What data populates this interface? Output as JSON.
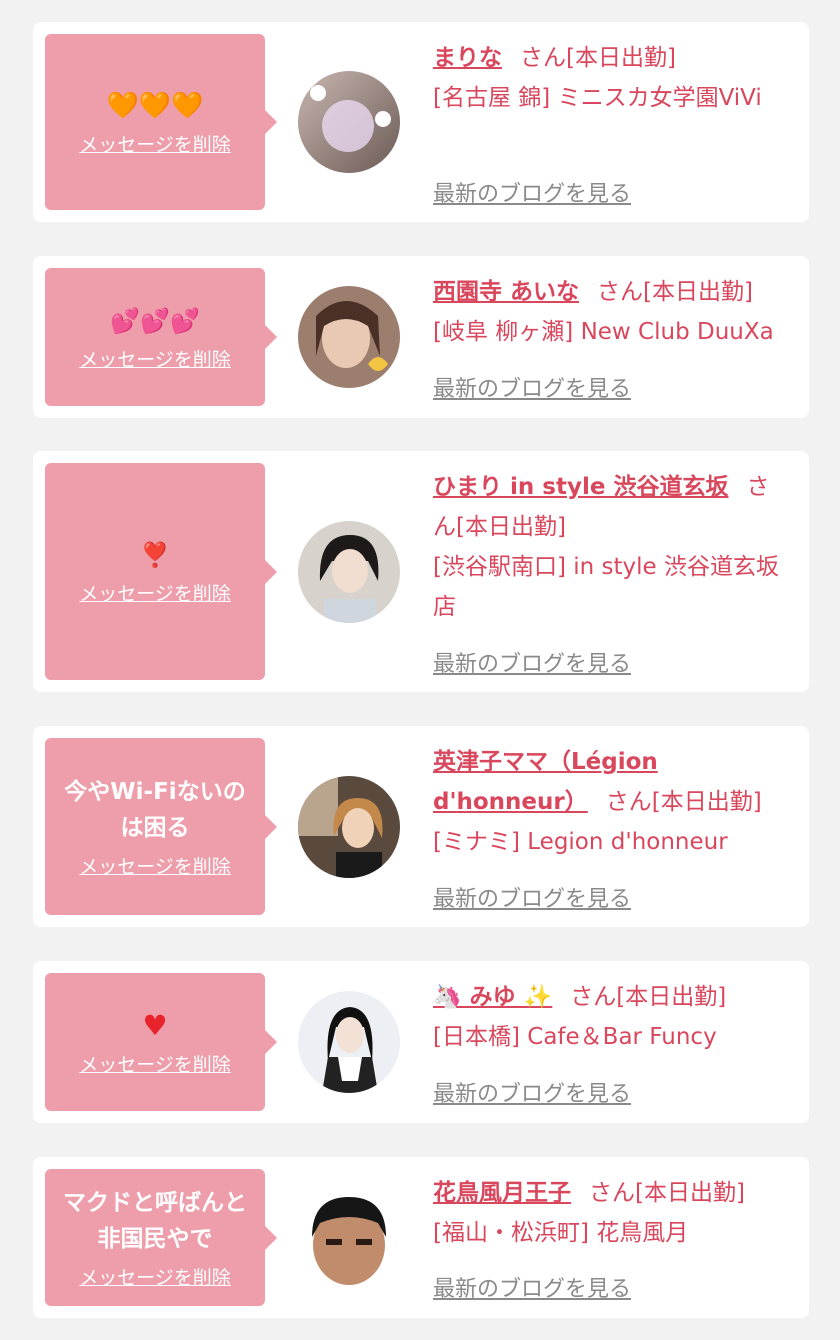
{
  "colors": {
    "background": "#f2f2f2",
    "bubble": "#ee9eaa",
    "accent": "#d9475d",
    "link_gray": "#8a8a8a"
  },
  "common": {
    "delete_label": "メッセージを削除",
    "san_label": "さん[本日出勤]",
    "blog_label": "最新のブログを見る"
  },
  "items": [
    {
      "message": "🧡🧡🧡",
      "name": "まりな",
      "shop": "[名古屋 錦] ミニスカ女学園ViVi",
      "avatar": "photo-avatar"
    },
    {
      "message": "💕💕💕",
      "name": "西園寺 あいな",
      "shop": "[岐阜 柳ヶ瀬] New Club DuuXa",
      "avatar": "photo-avatar"
    },
    {
      "message": "❣️",
      "name": "ひまり in style 渋谷道玄坂",
      "shop": "[渋谷駅南口] in style 渋谷道玄坂店",
      "avatar": "photo-avatar"
    },
    {
      "message": "今やWi-Fiないのは困る",
      "name": "英津子ママ（Légion d'honneur）",
      "shop": "[ミナミ] Legion d'honneur",
      "avatar": "photo-avatar"
    },
    {
      "message": "♥",
      "name": "🦄 みゆ ✨",
      "shop": "[日本橋] Cafe＆Bar Funcy",
      "avatar": "photo-avatar"
    },
    {
      "message": "マクドと呼ばんと非国民やで",
      "name": "花鳥風月王子",
      "shop": "[福山・松浜町] 花鳥風月",
      "avatar": "photo-avatar"
    }
  ]
}
